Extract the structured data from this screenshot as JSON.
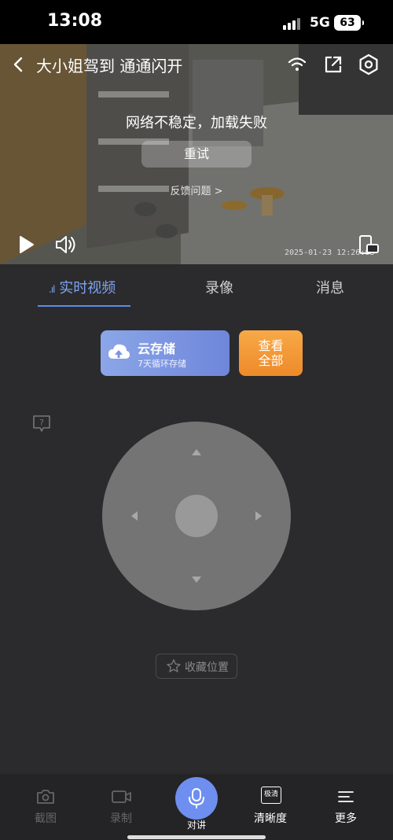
{
  "status_bar": {
    "time": "13:08",
    "network": "5G",
    "battery": "63"
  },
  "header": {
    "title": "大小姐驾到 通通闪开"
  },
  "player": {
    "error_message": "网络不稳定，加载失败",
    "retry_label": "重试",
    "feedback_label": "反馈问题 >",
    "timestamp": "2025-01-23 12:26:03"
  },
  "tabs": [
    {
      "label": "实时视频",
      "active": true
    },
    {
      "label": "录像",
      "active": false
    },
    {
      "label": "消息",
      "active": false
    }
  ],
  "cloud_storage": {
    "title": "云存储",
    "subtitle": "7天循环存储"
  },
  "view_all": {
    "line1": "查看",
    "line2": "全部"
  },
  "favorite": {
    "label": "收藏位置"
  },
  "toolbar": [
    {
      "label": "截图",
      "icon": "camera-icon",
      "enabled": false
    },
    {
      "label": "录制",
      "icon": "video-record-icon",
      "enabled": false
    },
    {
      "label": "对讲",
      "icon": "microphone-icon",
      "enabled": true
    },
    {
      "label": "清晰度",
      "icon": "resolution-icon",
      "badge": "极清",
      "enabled": true
    },
    {
      "label": "更多",
      "icon": "menu-icon",
      "enabled": true
    }
  ],
  "colors": {
    "accent": "#6e8ff0",
    "tab_active": "#7fa3f0",
    "orange": "#f19a36",
    "background": "#2b2b2d"
  }
}
